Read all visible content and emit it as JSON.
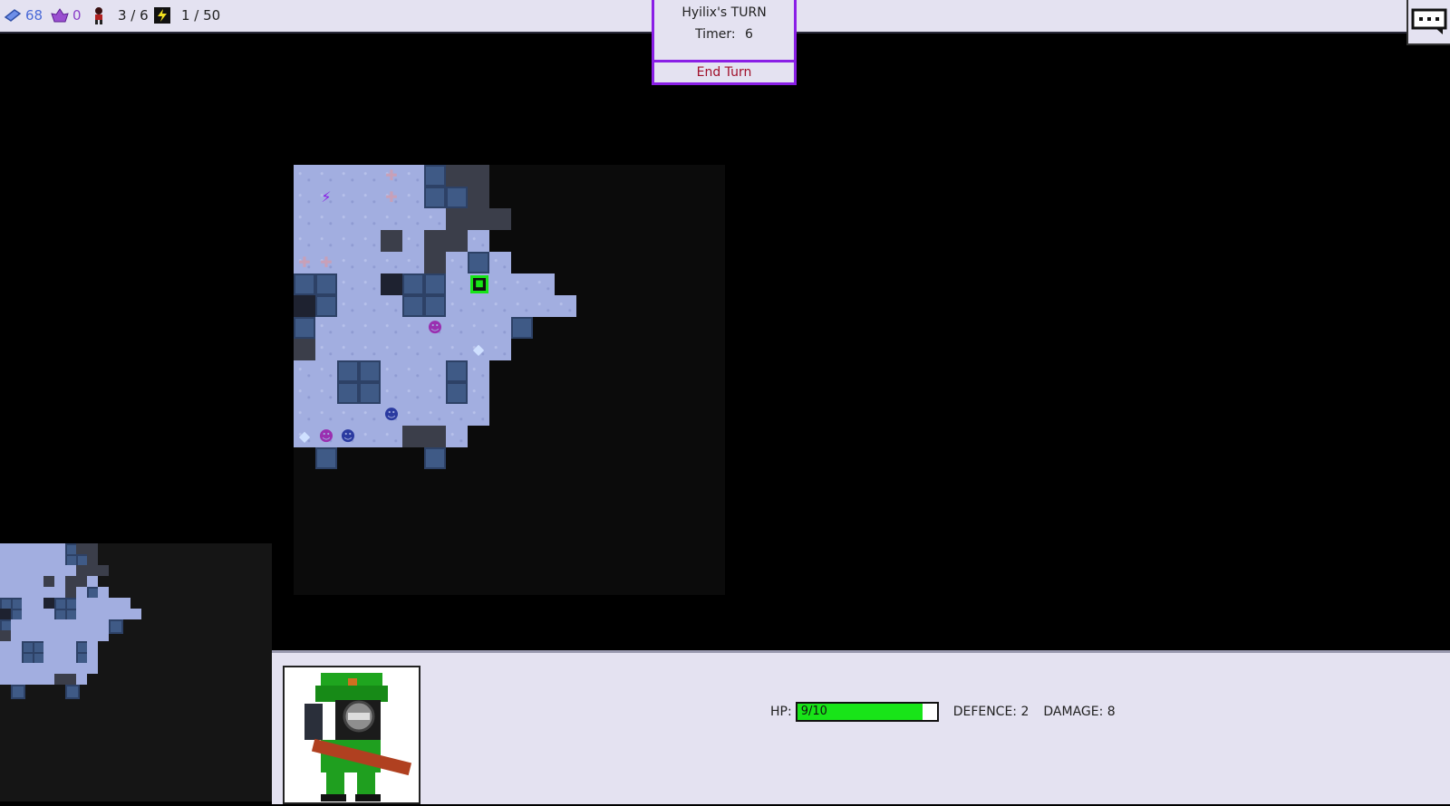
{
  "resources": {
    "crystals": "68",
    "gems": "0",
    "units": "3 / 6",
    "energy": "1 / 50"
  },
  "turn": {
    "player_turn": "Hyilix's TURN",
    "timer_label": "Timer:",
    "timer_value": "6",
    "end_turn": "End Turn"
  },
  "unit": {
    "hp_label": "HP:",
    "hp_value": "9/10",
    "hp_fraction": 0.9,
    "defence": "DEFENCE: 2",
    "damage": "DAMAGE: 8"
  },
  "colors": {
    "accent": "#8a1fe6",
    "end_turn_text": "#a0102a",
    "hp_bar": "#18e418",
    "panel_bg": "#e4e2f1"
  }
}
